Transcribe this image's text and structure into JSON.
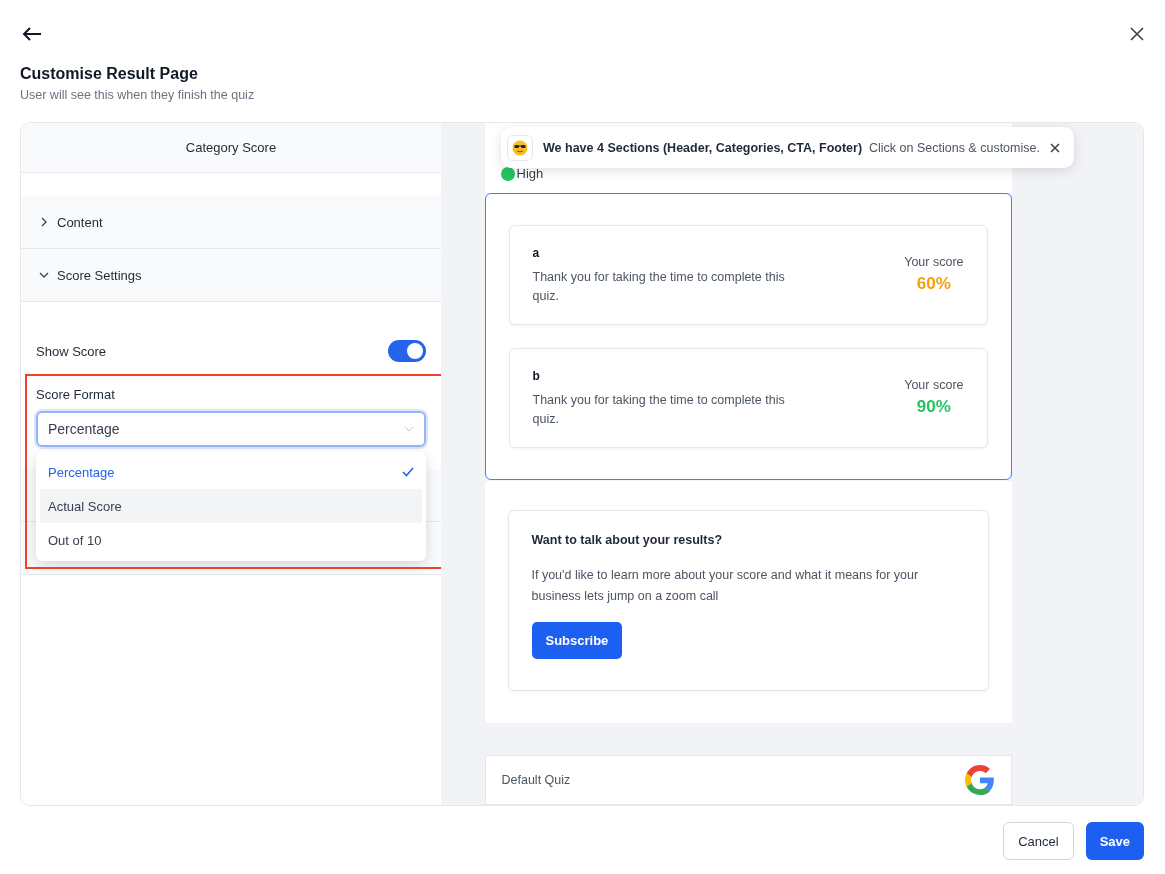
{
  "header": {
    "title": "Customise Result Page",
    "subtitle": "User will see this when they finish the quiz"
  },
  "editor": {
    "tab": "Category Score",
    "accordions": [
      {
        "label": "Content",
        "expanded": false
      },
      {
        "label": "Score Settings",
        "expanded": true
      }
    ],
    "show_score": {
      "label": "Show Score",
      "on": true
    },
    "score_format": {
      "label": "Score Format",
      "value": "Percentage",
      "highlighted": true,
      "options": [
        {
          "label": "Percentage",
          "selected": true,
          "hovered": false
        },
        {
          "label": "Actual Score",
          "selected": false,
          "hovered": true
        },
        {
          "label": "Out of 10",
          "selected": false,
          "hovered": false
        }
      ]
    }
  },
  "preview": {
    "toast": {
      "title": "We have 4 Sections (Header, Categories, CTA, Footer)",
      "text": "Click on Sections & customise."
    },
    "legend": [
      {
        "label": "High",
        "color": "#22c55e"
      }
    ],
    "categories_selected": true,
    "categories": [
      {
        "name": "a",
        "description": "Thank you for taking the time to complete this quiz.",
        "score_label": "Your score",
        "score": "60%",
        "color": "#f59e0b"
      },
      {
        "name": "b",
        "description": "Thank you for taking the time to complete this quiz.",
        "score_label": "Your score",
        "score": "90%",
        "color": "#22c55e"
      }
    ],
    "cta": {
      "title": "Want to talk about your results?",
      "text": "If you'd like to learn more about your score and what it means for your business lets jump on a zoom call",
      "button": "Subscribe"
    },
    "footer": {
      "name": "Default Quiz"
    }
  },
  "buttons": [
    {
      "label": "Cancel",
      "kind": "secondary"
    },
    {
      "label": "Save",
      "kind": "primary"
    }
  ]
}
